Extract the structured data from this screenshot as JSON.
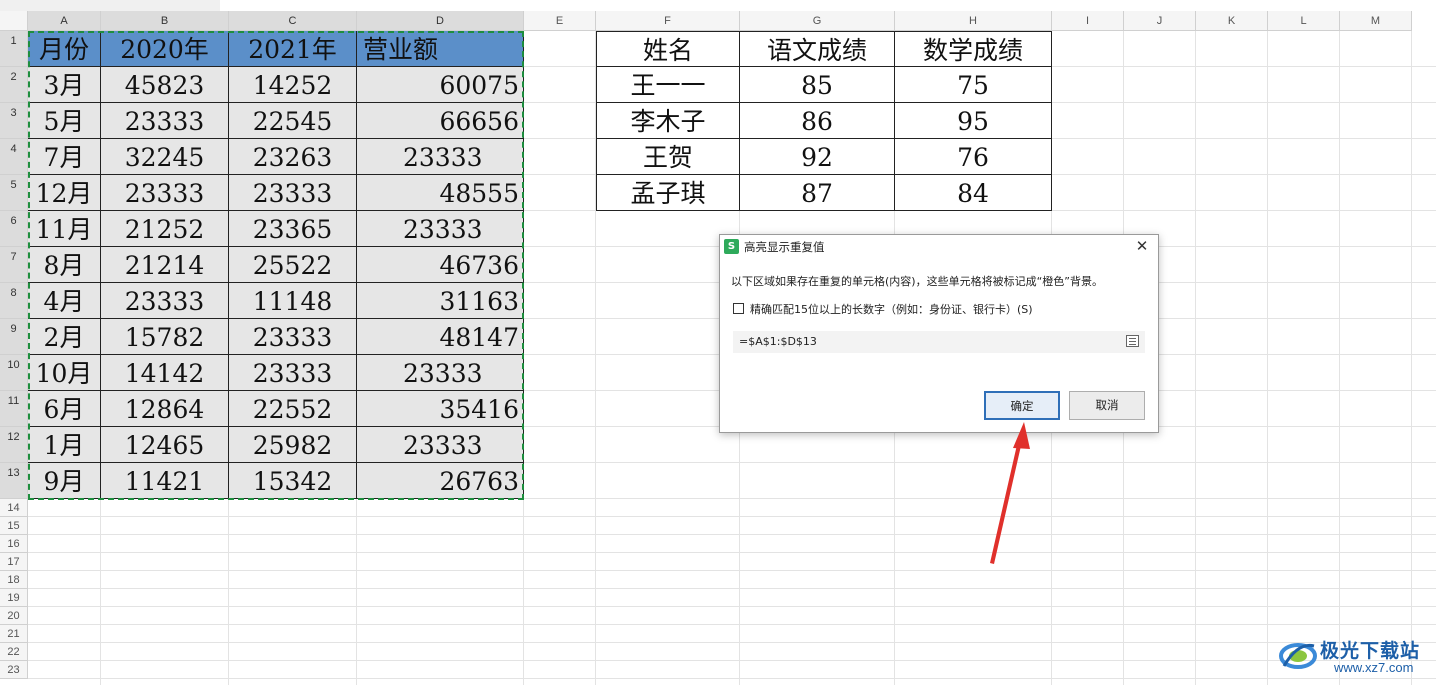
{
  "columns": [
    "A",
    "B",
    "C",
    "D",
    "E",
    "F",
    "G",
    "H",
    "I",
    "J",
    "K",
    "L",
    "M"
  ],
  "rows": [
    "1",
    "2",
    "3",
    "4",
    "5",
    "6",
    "7",
    "8",
    "9",
    "10",
    "11",
    "12",
    "13",
    "14",
    "15",
    "16",
    "17",
    "18",
    "19",
    "20",
    "21",
    "22",
    "23"
  ],
  "table1": {
    "headers": [
      "月份",
      "2020年",
      "2021年",
      "营业额"
    ],
    "rows": [
      [
        "3月",
        "45823",
        "14252",
        "60075"
      ],
      [
        "5月",
        "23333",
        "22545",
        "66656"
      ],
      [
        "7月",
        "32245",
        "23263",
        "23333"
      ],
      [
        "12月",
        "23333",
        "23333",
        "48555"
      ],
      [
        "11月",
        "21252",
        "23365",
        "23333"
      ],
      [
        "8月",
        "21214",
        "25522",
        "46736"
      ],
      [
        "4月",
        "23333",
        "11148",
        "31163"
      ],
      [
        "2月",
        "15782",
        "23333",
        "48147"
      ],
      [
        "10月",
        "14142",
        "23333",
        "23333"
      ],
      [
        "6月",
        "12864",
        "22552",
        "35416"
      ],
      [
        "1月",
        "12465",
        "25982",
        "23333"
      ],
      [
        "9月",
        "11421",
        "15342",
        "26763"
      ]
    ]
  },
  "table2": {
    "headers": [
      "姓名",
      "语文成绩",
      "数学成绩"
    ],
    "rows": [
      [
        "王一一",
        "85",
        "75"
      ],
      [
        "李木子",
        "86",
        "95"
      ],
      [
        "王贺",
        "92",
        "76"
      ],
      [
        "孟子琪",
        "87",
        "84"
      ]
    ]
  },
  "dialog": {
    "icon_letter": "S",
    "title": "高亮显示重复值",
    "description": "以下区域如果存在重复的单元格(内容)，这些单元格将被标记成“橙色”背景。",
    "checkbox_label": "精确匹配15位以上的长数字（例如：身份证、银行卡）(S)",
    "range_value": "=$A$1:$D$13",
    "ok_label": "确定",
    "cancel_label": "取消",
    "close_icon": "close-icon"
  },
  "watermark": {
    "text": "极光下载站",
    "url": "www.xz7.com"
  },
  "colors": {
    "header_fill": "#5b8fc9",
    "data_fill": "#e6e6e6",
    "selection": "#1e8e3e",
    "arrow": "#e0302b",
    "ok_border": "#2f6fb8"
  }
}
